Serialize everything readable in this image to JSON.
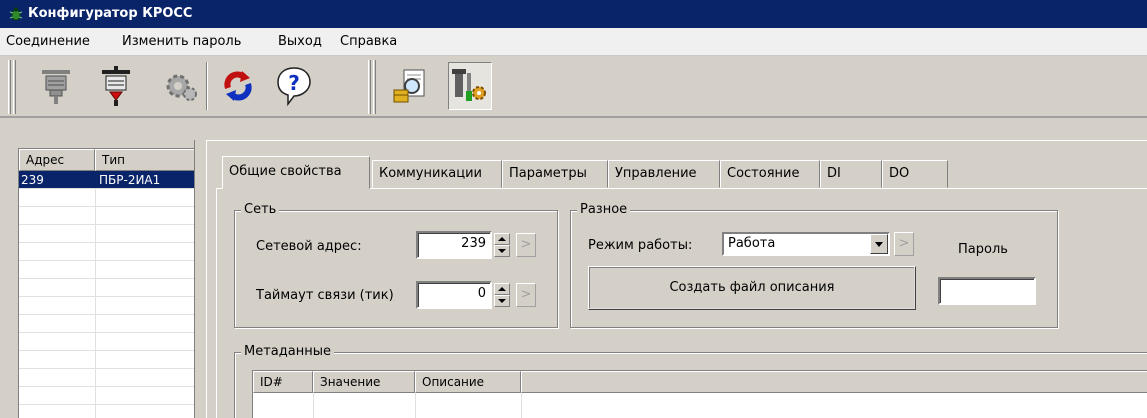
{
  "window": {
    "title": "Конфигуратор КРОСС"
  },
  "menu": [
    "Соединение",
    "Изменить пароль",
    "Выход",
    "Справка"
  ],
  "toolbar": {
    "buttons": [
      "connect-icon",
      "disconnect-icon",
      "settings-gear-icon",
      "refresh-icon",
      "help-icon",
      "search-document-icon",
      "tools-icon"
    ]
  },
  "device_list": {
    "columns": [
      "Адрес",
      "Тип"
    ],
    "rows": [
      {
        "address": "239",
        "type": "ПБР-2ИА1"
      }
    ]
  },
  "tabs": [
    "Общие свойства",
    "Коммуникации",
    "Параметры",
    "Управление",
    "Состояние",
    "DI",
    "DO"
  ],
  "network_group": {
    "title": "Сеть",
    "address_label": "Сетевой адрес:",
    "address_value": "239",
    "timeout_label": "Таймаут связи (тик)",
    "timeout_value": "0",
    "apply_glyph": ">"
  },
  "misc_group": {
    "title": "Разное",
    "mode_label": "Режим работы:",
    "mode_value": "Работа",
    "create_button": "Создать файл описания",
    "password_label": "Пароль",
    "password_value": ""
  },
  "metadata": {
    "title": "Метаданные",
    "columns": [
      "ID#",
      "Значение",
      "Описание"
    ]
  },
  "colors": {
    "title_bar": "#0a246a",
    "selection": "#0a246a",
    "face": "#d4d0c8"
  }
}
